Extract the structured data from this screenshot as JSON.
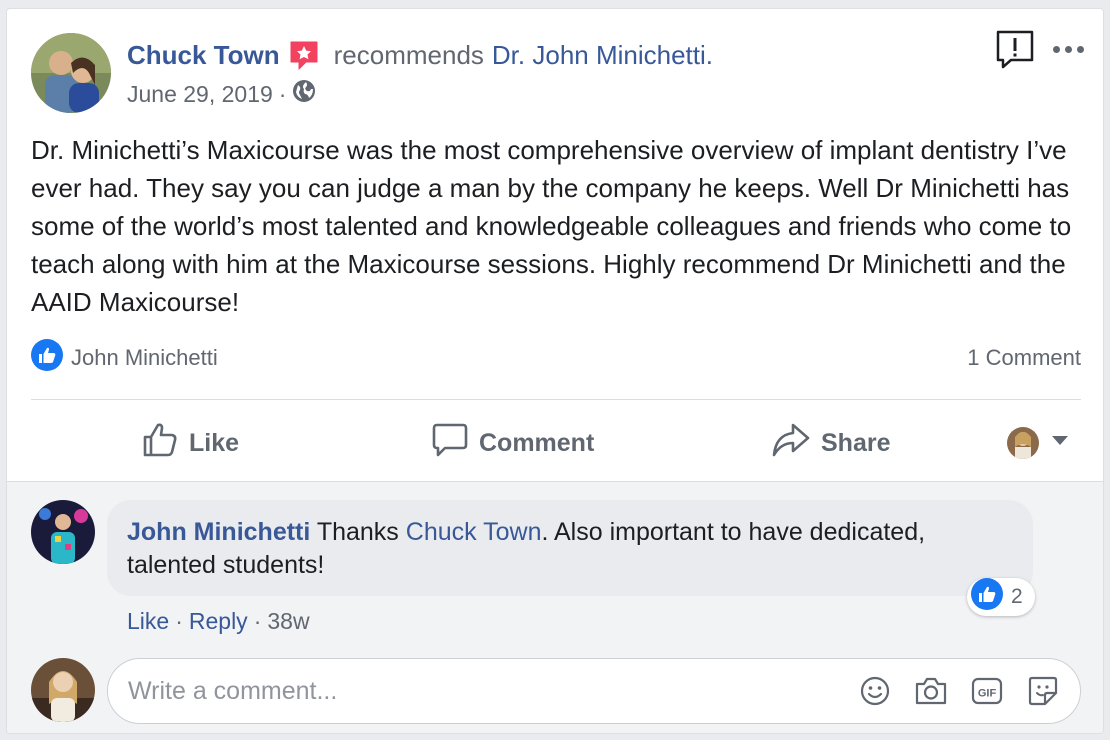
{
  "post": {
    "author": "Chuck Town",
    "verb": "recommends",
    "target": "Dr. John Minichetti.",
    "date": "June 29, 2019",
    "separator": "·",
    "text": "Dr. Minichetti’s Maxicourse was the most comprehensive overview of implant dentistry I’ve ever had. They say you can judge a man by the company he keeps. Well Dr Minichetti has some of the world’s most talented and knowledgeable colleagues and friends who come to teach along with him at the Maxicourse sessions. Highly recommend Dr Minichetti and the AAID Maxicourse!"
  },
  "reactions": {
    "names": "John Minichetti",
    "comment_count": "1 Comment"
  },
  "actions": {
    "like": "Like",
    "comment": "Comment",
    "share": "Share"
  },
  "comment": {
    "author": "John Minichetti",
    "text_before": " Thanks ",
    "mention": "Chuck Town",
    "text_after": ". Also important to have dedicated, talented students!",
    "reaction_count": "2",
    "like": "Like",
    "reply": "Reply",
    "age": "38w",
    "sep": "·"
  },
  "composer": {
    "placeholder": "Write a comment..."
  },
  "colors": {
    "link": "#385898",
    "like_blue": "#1877f2",
    "recommend_red": "#f3425f"
  },
  "icons": [
    "recommend-star-icon",
    "globe-icon",
    "report-icon",
    "more-icon",
    "like-reaction-icon",
    "thumbs-up-icon",
    "comment-icon",
    "share-icon",
    "chevron-down-icon",
    "emoji-icon",
    "camera-icon",
    "gif-icon",
    "sticker-icon"
  ]
}
